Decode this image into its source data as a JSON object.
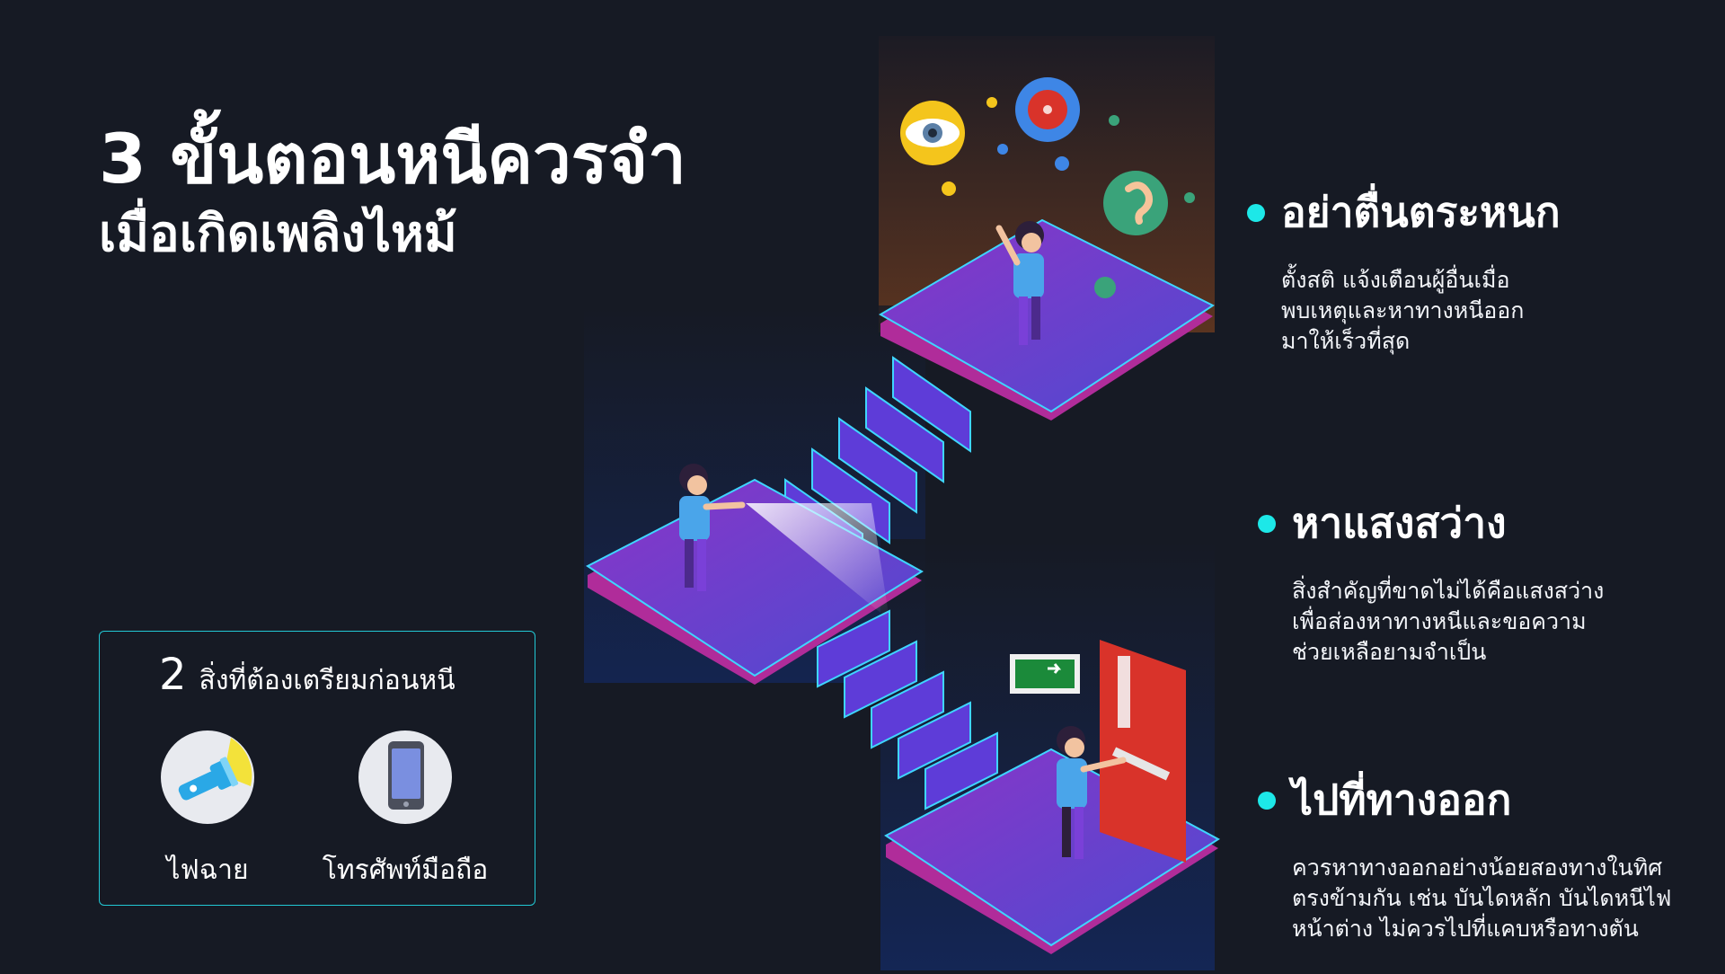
{
  "title": {
    "line1": "3 ขั้นตอนหนีควรจำ",
    "line2": "เมื่อเกิดเพลิงไหม้"
  },
  "prepare": {
    "count": "2",
    "heading": "สิ่งที่ต้องเตรียมก่อนหนี",
    "items": [
      {
        "label": "ไฟฉาย",
        "icon": "flashlight-icon"
      },
      {
        "label": "โทรศัพท์มือถือ",
        "icon": "mobile-phone-icon"
      }
    ]
  },
  "steps": [
    {
      "title": "อย่าตื่นตระหนก",
      "lines": [
        "ตั้งสติ แจ้งเตือนผู้อื่นเมื่อ",
        "พบเหตุและหาทางหนีออก",
        "มาให้เร็วที่สุด"
      ]
    },
    {
      "title": "หาแสงสว่าง",
      "lines": [
        "สิ่งสำคัญที่ขาดไม่ได้คือแสงสว่าง",
        "เพื่อส่องหาทางหนีและขอความ",
        "ช่วยเหลือยามจำเป็น"
      ]
    },
    {
      "title": "ไปที่ทางออก",
      "lines": [
        "ควรหาทางออกอย่างน้อยสองทางในทิศ",
        "ตรงข้ามกัน เช่น บันไดหลัก บันไดหนีไฟ",
        "หน้าต่าง ไม่ควรไปที่แคบหรือทางตัน"
      ]
    }
  ],
  "colors": {
    "background": "#161a24",
    "accent": "#1de8e8",
    "platform": "#6a3fc8",
    "door": "#d9332a",
    "exit_sign": "#1b8a3a"
  }
}
